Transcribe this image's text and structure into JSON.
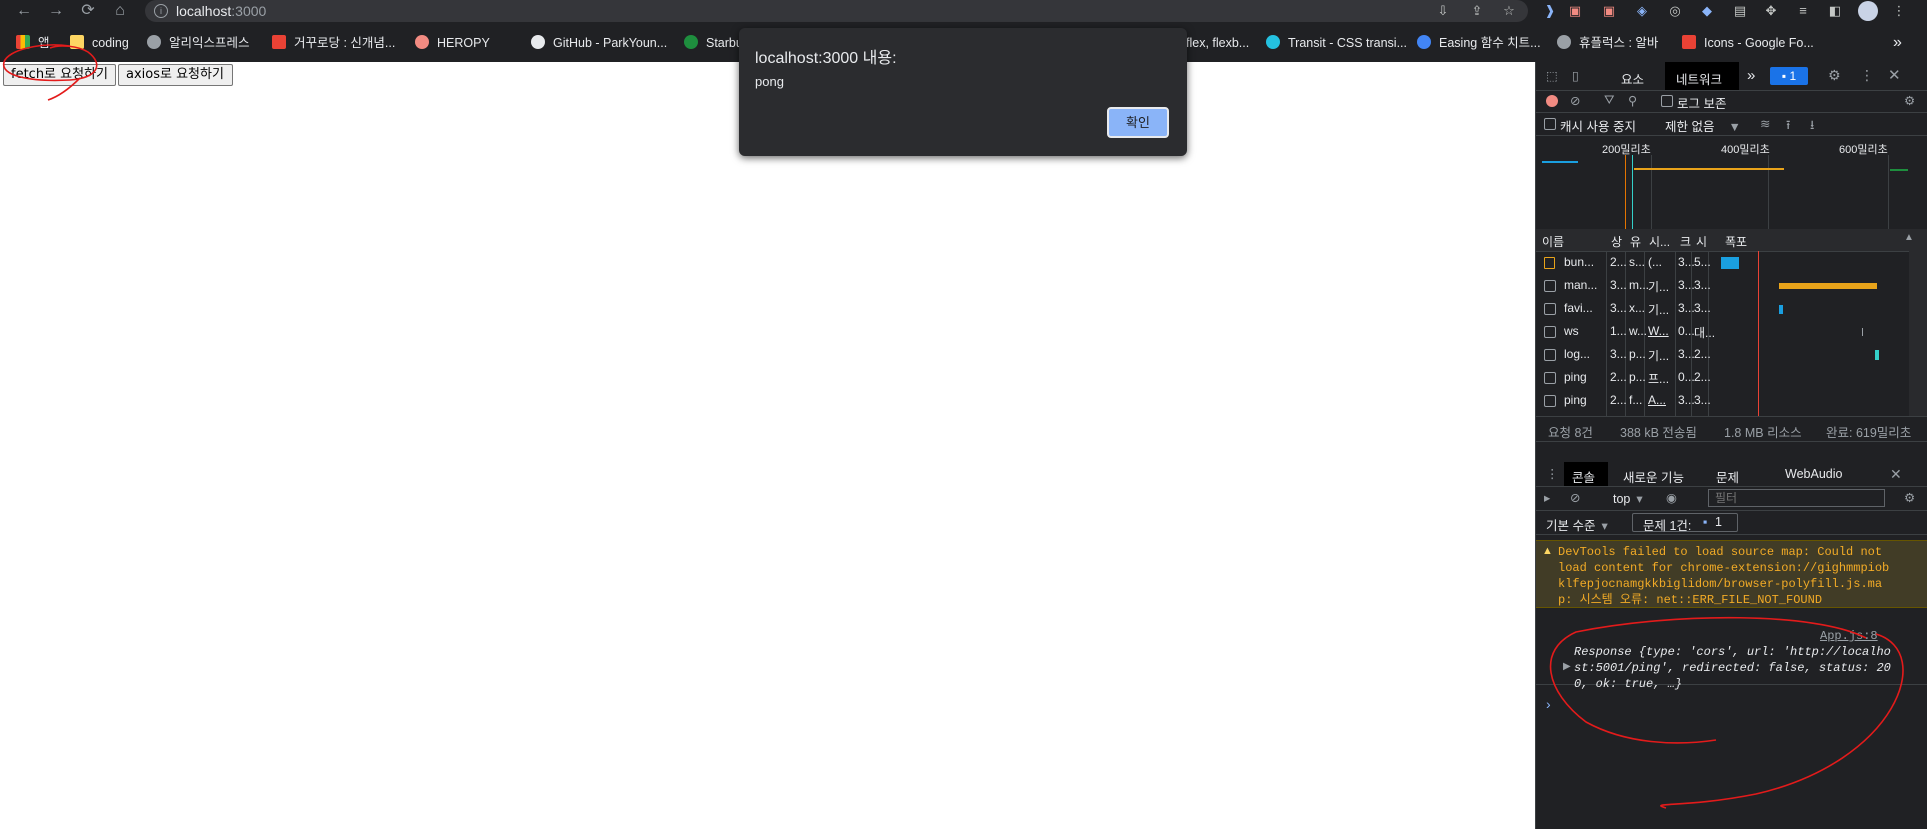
{
  "browser": {
    "url_host": "localhost",
    "url_port": ":3000",
    "bookmarks": [
      {
        "label": "앱",
        "color": "#e8eaed"
      },
      {
        "label": "coding",
        "color": "#fdd663"
      },
      {
        "label": "알리익스프레스",
        "color": "#9aa0a6"
      },
      {
        "label": "거꾸로당 : 신개념...",
        "color": "#e94235"
      },
      {
        "label": "HEROPY",
        "color": "#f28b82"
      },
      {
        "label": "GitHub - ParkYoun...",
        "color": "#e8eaed"
      },
      {
        "label": "Starbu",
        "color": "#1e8e3e"
      },
      {
        "label": "flex, flexb...",
        "color": "#9aa0a6"
      },
      {
        "label": "Transit - CSS transi...",
        "color": "#24c1e0"
      },
      {
        "label": "Easing 함수 치트...",
        "color": "#4285f4"
      },
      {
        "label": "휴플럭스 : 알바",
        "color": "#9aa0a6"
      },
      {
        "label": "Icons - Google Fo...",
        "color": "#e94235"
      }
    ],
    "bookmarks_more": "»"
  },
  "page": {
    "fetch_button": "fetch로 요청하기",
    "axios_button": "axios로 요청하기"
  },
  "dialog": {
    "title": "localhost:3000 내용:",
    "message": "pong",
    "ok": "확인"
  },
  "devtools": {
    "tabs": [
      "요소",
      "네트워크"
    ],
    "more_tabs": "»",
    "badge": "1",
    "preserve_log": "로그 보존",
    "disable_cache": "캐시 사용 중지",
    "throttling": "제한 없음",
    "timeline_labels": [
      "200밀리초",
      "400밀리초",
      "600밀리초"
    ],
    "columns": [
      "이름",
      "상",
      "유",
      "시...",
      "크",
      "시",
      "폭포"
    ],
    "rows": [
      {
        "name": "bun...",
        "c1": "2...",
        "c2": "s...",
        "c3": "(...",
        "c4": "3...",
        "c5": "5..."
      },
      {
        "name": "man...",
        "c1": "3...",
        "c2": "m...",
        "c3": "기...",
        "c4": "3...",
        "c5": "3..."
      },
      {
        "name": "favi...",
        "c1": "3...",
        "c2": "x...",
        "c3": "기...",
        "c4": "3...",
        "c5": "3..."
      },
      {
        "name": "ws",
        "c1": "1...",
        "c2": "w...",
        "c3": "W...",
        "c4": "0...",
        "c5": "대..."
      },
      {
        "name": "log...",
        "c1": "3...",
        "c2": "p...",
        "c3": "기...",
        "c4": "3...",
        "c5": "2..."
      },
      {
        "name": "ping",
        "c1": "2...",
        "c2": "p...",
        "c3": "프...",
        "c4": "0...",
        "c5": "2..."
      },
      {
        "name": "ping",
        "c1": "2...",
        "c2": "f...",
        "c3": "A...",
        "c4": "3...",
        "c5": "3..."
      }
    ],
    "summary": [
      "요청 8건",
      "388 kB 전송됨",
      "1.8 MB 리소스",
      "완료: 619밀리초"
    ],
    "drawer_tabs": [
      "콘솔",
      "새로운 기능",
      "문제",
      "WebAudio"
    ],
    "context": "top",
    "filter_placeholder": "필터",
    "levels": "기본 수준",
    "issues": "문제 1건:",
    "issues_count": "1",
    "warning_lines": [
      "DevTools failed to load source map: Could not",
      "load content for chrome-extension://gighmmpiob",
      "klfepjocnamgkkbiglidom/browser-polyfill.js.ma",
      "p: 시스템 오류: net::ERR_FILE_NOT_FOUND"
    ],
    "log_source": "App.js:8",
    "log_lines": [
      "Response {type: 'cors', url: 'http://localho",
      "st:5001/ping', redirected: false, status: 20",
      "0, ok: true, …}"
    ],
    "prompt": "›"
  }
}
